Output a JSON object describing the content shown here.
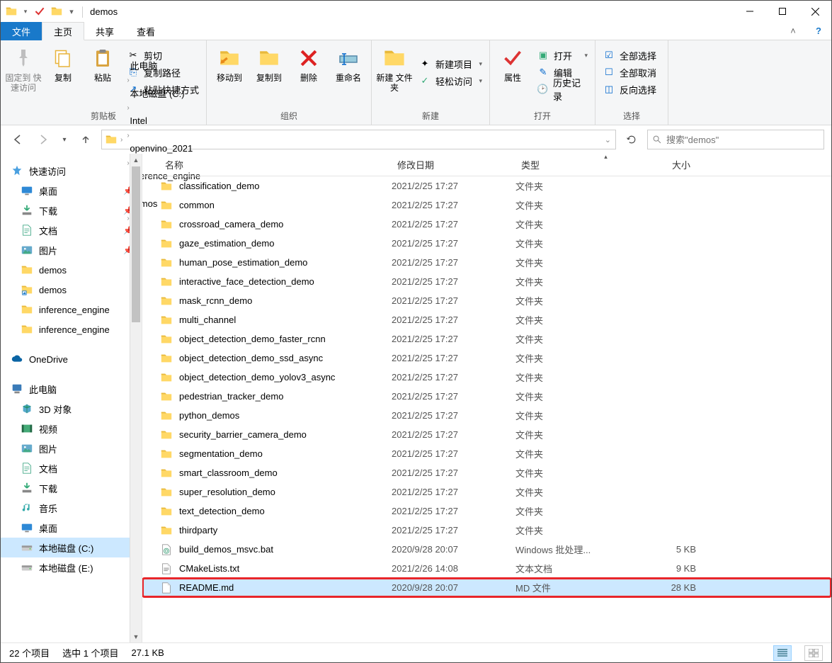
{
  "window": {
    "title": "demos"
  },
  "tabs": {
    "file": "文件",
    "home": "主页",
    "share": "共享",
    "view": "查看"
  },
  "ribbon": {
    "clipboard": {
      "label": "剪贴板",
      "pin": "固定到\n快速访问",
      "copy": "复制",
      "paste": "粘贴",
      "cut": "剪切",
      "copypath": "复制路径",
      "pasteshortcut": "粘贴快捷方式"
    },
    "organize": {
      "label": "组织",
      "moveto": "移动到",
      "copyto": "复制到",
      "delete": "删除",
      "rename": "重命名"
    },
    "new": {
      "label": "新建",
      "newfolder": "新建\n文件夹",
      "newitem": "新建项目",
      "easyaccess": "轻松访问"
    },
    "open": {
      "label": "打开",
      "properties": "属性",
      "open": "打开",
      "edit": "编辑",
      "history": "历史记录"
    },
    "select": {
      "label": "选择",
      "all": "全部选择",
      "none": "全部取消",
      "invert": "反向选择"
    }
  },
  "breadcrumbs": [
    "此电脑",
    "本地磁盘 (C:)",
    "Intel",
    "openvino_2021",
    "inference_engine",
    "demos"
  ],
  "search": {
    "placeholder": "搜索\"demos\""
  },
  "nav": {
    "quick": {
      "label": "快速访问",
      "items": [
        {
          "label": "桌面",
          "icon": "desktop",
          "pin": true
        },
        {
          "label": "下载",
          "icon": "download",
          "pin": true
        },
        {
          "label": "文档",
          "icon": "doc",
          "pin": true
        },
        {
          "label": "图片",
          "icon": "pic",
          "pin": true
        },
        {
          "label": "demos",
          "icon": "folder",
          "pin": false
        },
        {
          "label": "demos",
          "icon": "folder-sc",
          "pin": false
        },
        {
          "label": "inference_engine",
          "icon": "folder",
          "pin": false
        },
        {
          "label": "inference_engine",
          "icon": "folder",
          "pin": false
        }
      ]
    },
    "onedrive": "OneDrive",
    "thispc": {
      "label": "此电脑",
      "items": [
        {
          "label": "3D 对象",
          "icon": "3d"
        },
        {
          "label": "视频",
          "icon": "video"
        },
        {
          "label": "图片",
          "icon": "pic"
        },
        {
          "label": "文档",
          "icon": "doc"
        },
        {
          "label": "下载",
          "icon": "download"
        },
        {
          "label": "音乐",
          "icon": "music"
        },
        {
          "label": "桌面",
          "icon": "desktop"
        },
        {
          "label": "本地磁盘 (C:)",
          "icon": "drive",
          "selected": true
        },
        {
          "label": "本地磁盘 (E:)",
          "icon": "drive"
        }
      ]
    }
  },
  "columns": {
    "name": "名称",
    "date": "修改日期",
    "type": "类型",
    "size": "大小"
  },
  "files": [
    {
      "name": "classification_demo",
      "date": "2021/2/25 17:27",
      "type": "文件夹",
      "size": "",
      "icon": "folder"
    },
    {
      "name": "common",
      "date": "2021/2/25 17:27",
      "type": "文件夹",
      "size": "",
      "icon": "folder"
    },
    {
      "name": "crossroad_camera_demo",
      "date": "2021/2/25 17:27",
      "type": "文件夹",
      "size": "",
      "icon": "folder"
    },
    {
      "name": "gaze_estimation_demo",
      "date": "2021/2/25 17:27",
      "type": "文件夹",
      "size": "",
      "icon": "folder"
    },
    {
      "name": "human_pose_estimation_demo",
      "date": "2021/2/25 17:27",
      "type": "文件夹",
      "size": "",
      "icon": "folder"
    },
    {
      "name": "interactive_face_detection_demo",
      "date": "2021/2/25 17:27",
      "type": "文件夹",
      "size": "",
      "icon": "folder"
    },
    {
      "name": "mask_rcnn_demo",
      "date": "2021/2/25 17:27",
      "type": "文件夹",
      "size": "",
      "icon": "folder"
    },
    {
      "name": "multi_channel",
      "date": "2021/2/25 17:27",
      "type": "文件夹",
      "size": "",
      "icon": "folder"
    },
    {
      "name": "object_detection_demo_faster_rcnn",
      "date": "2021/2/25 17:27",
      "type": "文件夹",
      "size": "",
      "icon": "folder"
    },
    {
      "name": "object_detection_demo_ssd_async",
      "date": "2021/2/25 17:27",
      "type": "文件夹",
      "size": "",
      "icon": "folder"
    },
    {
      "name": "object_detection_demo_yolov3_async",
      "date": "2021/2/25 17:27",
      "type": "文件夹",
      "size": "",
      "icon": "folder"
    },
    {
      "name": "pedestrian_tracker_demo",
      "date": "2021/2/25 17:27",
      "type": "文件夹",
      "size": "",
      "icon": "folder"
    },
    {
      "name": "python_demos",
      "date": "2021/2/25 17:27",
      "type": "文件夹",
      "size": "",
      "icon": "folder"
    },
    {
      "name": "security_barrier_camera_demo",
      "date": "2021/2/25 17:27",
      "type": "文件夹",
      "size": "",
      "icon": "folder"
    },
    {
      "name": "segmentation_demo",
      "date": "2021/2/25 17:27",
      "type": "文件夹",
      "size": "",
      "icon": "folder"
    },
    {
      "name": "smart_classroom_demo",
      "date": "2021/2/25 17:27",
      "type": "文件夹",
      "size": "",
      "icon": "folder"
    },
    {
      "name": "super_resolution_demo",
      "date": "2021/2/25 17:27",
      "type": "文件夹",
      "size": "",
      "icon": "folder"
    },
    {
      "name": "text_detection_demo",
      "date": "2021/2/25 17:27",
      "type": "文件夹",
      "size": "",
      "icon": "folder"
    },
    {
      "name": "thirdparty",
      "date": "2021/2/25 17:27",
      "type": "文件夹",
      "size": "",
      "icon": "folder"
    },
    {
      "name": "build_demos_msvc.bat",
      "date": "2020/9/28 20:07",
      "type": "Windows 批处理...",
      "size": "5 KB",
      "icon": "bat"
    },
    {
      "name": "CMakeLists.txt",
      "date": "2021/2/26 14:08",
      "type": "文本文档",
      "size": "9 KB",
      "icon": "txt"
    },
    {
      "name": "README.md",
      "date": "2020/9/28 20:07",
      "type": "MD 文件",
      "size": "28 KB",
      "icon": "file",
      "selected": true,
      "highlight": true
    }
  ],
  "status": {
    "count": "22 个项目",
    "selection": "选中 1 个项目",
    "size": "27.1 KB"
  }
}
